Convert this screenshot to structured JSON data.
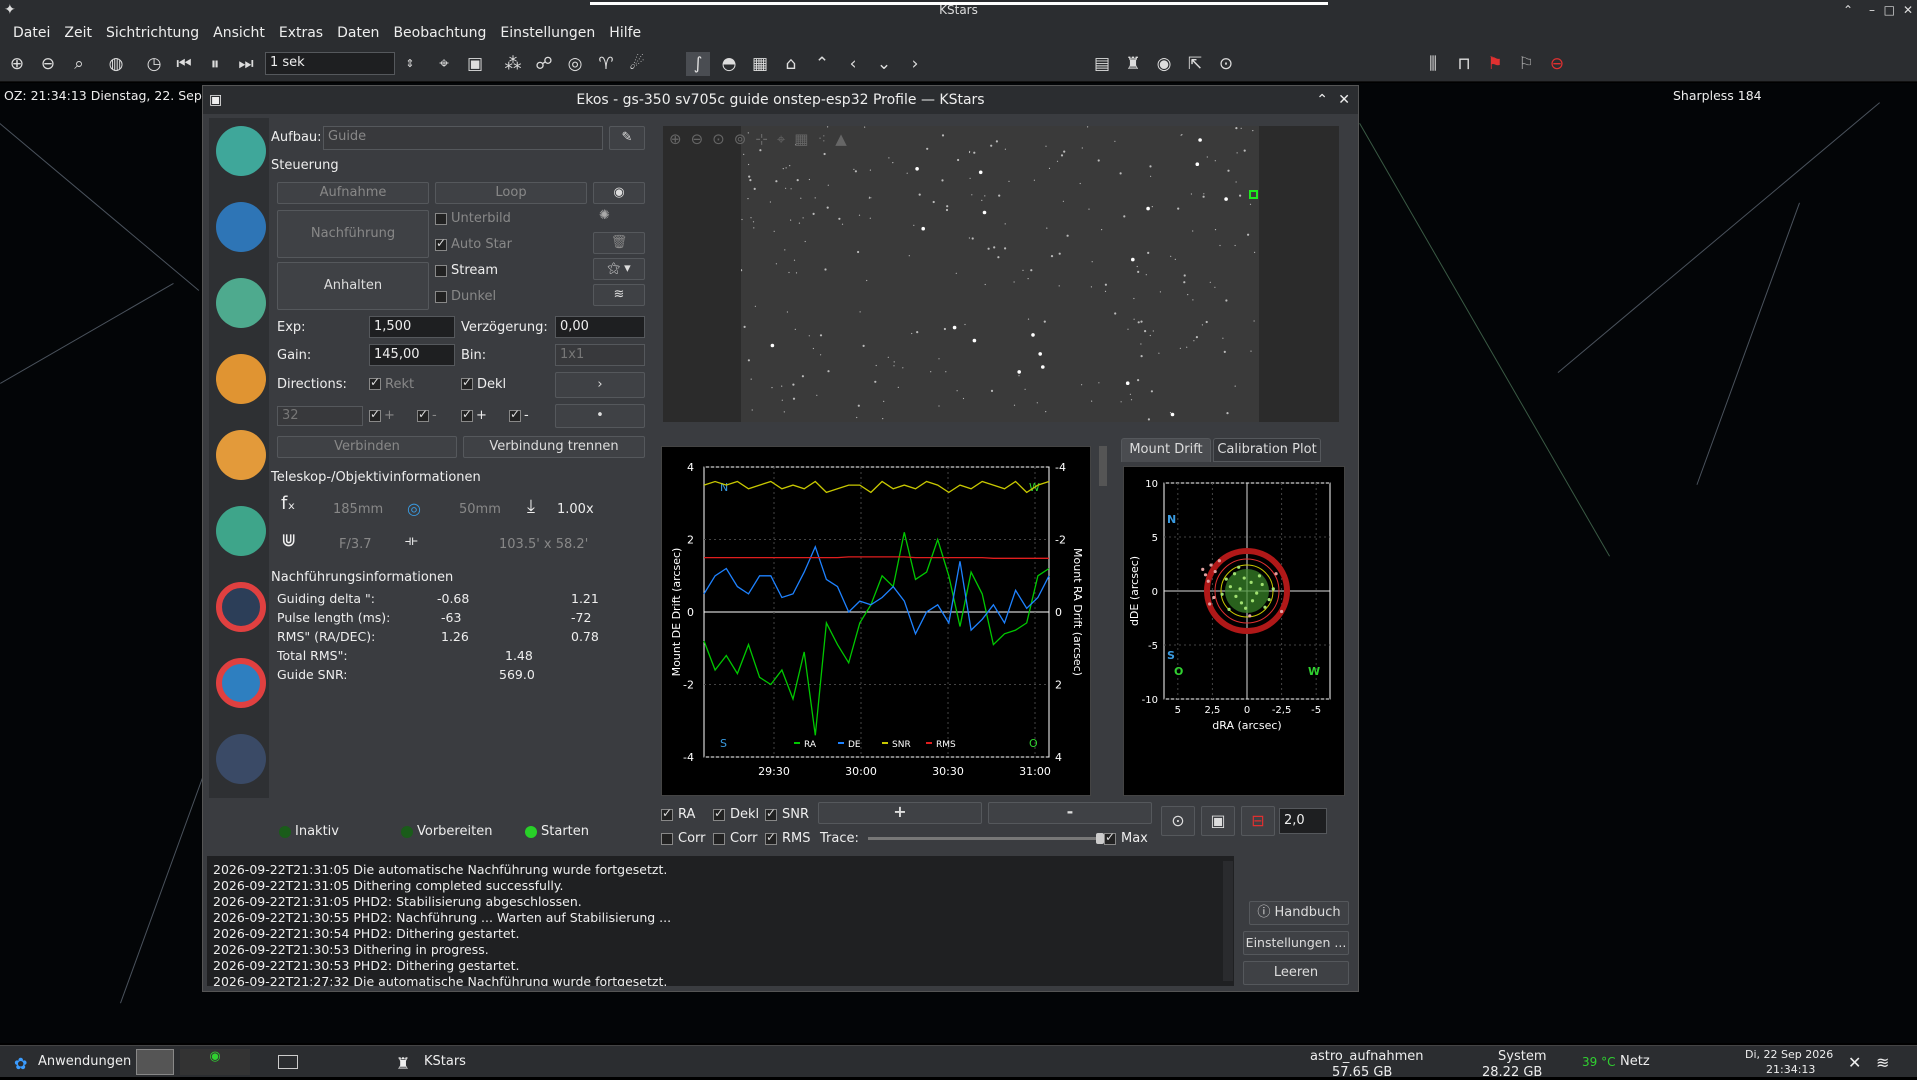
{
  "window_title": "KStars",
  "menu": [
    "Datei",
    "Zeit",
    "Sichtrichtung",
    "Ansicht",
    "Extras",
    "Daten",
    "Beobachtung",
    "Einstellungen",
    "Hilfe"
  ],
  "toolbar": {
    "time_step": "1 sek"
  },
  "sky": {
    "clock": "OZ: 21:34:13  Dienstag, 22. Sep",
    "object": "Sharpless 184"
  },
  "ekos": {
    "title": "Ekos - gs-350 sv705c guide onstep-esp32 Profile — KStars",
    "setup_label": "Aufbau:",
    "setup_value": "Guide",
    "control_title": "Steuerung",
    "capture_btn": "Aufnahme",
    "loop_btn": "Loop",
    "guide_btn": "Nachführung",
    "stop_btn": "Anhalten",
    "subframe": "Unterbild",
    "autostar": "Auto Star",
    "stream": "Stream",
    "dark": "Dunkel",
    "exp_label": "Exp:",
    "exp_value": "1,500",
    "delay_label": "Verzögerung:",
    "delay_value": "0,00",
    "gain_label": "Gain:",
    "gain_value": "145,00",
    "bin_label": "Bin:",
    "bin_value": "1x1",
    "directions_label": "Directions:",
    "ra_label": "Rekt",
    "de_label": "Dekl",
    "box_value": "32",
    "plus": "+",
    "minus": "-",
    "connect_btn": "Verbinden",
    "disconnect_btn": "Verbindung trennen",
    "scope_title": "Teleskop-/Objektivinformationen",
    "focal": "185mm",
    "aperture": "50mm",
    "reducer": "1.00x",
    "fratio": "F/3.7",
    "fov": "103.5' x 58.2'",
    "guide_info_title": "Nachführungsinformationen",
    "delta_label": "Guiding delta \":",
    "delta_ra": "-0.68",
    "delta_de": "1.21",
    "pulse_label": "Pulse length (ms):",
    "pulse_ra": "-63",
    "pulse_de": "-72",
    "rms_label": "RMS\" (RA/DEC):",
    "rms_ra": "1.26",
    "rms_de": "0.78",
    "total_rms_label": "Total RMS\":",
    "total_rms": "1.48",
    "snr_label": "Guide SNR:",
    "snr": "569.0",
    "status_inactive": "Inaktiv",
    "status_prepare": "Vorbereiten",
    "status_start": "Starten",
    "tab_drift": "Mount Drift",
    "tab_calib": "Calibration Plot",
    "cb_ra": "RA",
    "cb_dekl": "Dekl",
    "cb_snr": "SNR",
    "cb_corr1": "Corr",
    "cb_corr2": "Corr",
    "cb_rms": "RMS",
    "trace_label": "Trace:",
    "max_label": "Max",
    "zoom_value": "2,0",
    "btn_plus": "+",
    "btn_minus": "-",
    "handbook": "Handbuch",
    "settings": "Einstellungen ...",
    "clear": "Leeren"
  },
  "log": [
    "2026-09-22T21:31:05 Die automatische Nachführung wurde fortgesetzt.",
    "2026-09-22T21:31:05 Dithering completed successfully.",
    "2026-09-22T21:31:05 PHD2: Stabilisierung abgeschlossen.",
    "2026-09-22T21:30:55 PHD2: Nachführung ... Warten auf Stabilisierung ...",
    "2026-09-22T21:30:54 PHD2: Dithering gestartet.",
    "2026-09-22T21:30:53 Dithering in progress.",
    "2026-09-22T21:30:53 PHD2: Dithering gestartet.",
    "2026-09-22T21:27:32 Die automatische Nachführung wurde fortgesetzt."
  ],
  "chart_data": [
    {
      "type": "line",
      "title": "",
      "xlabel": "",
      "ylabel": "Mount DE Drift (arcsec)",
      "y2label": "Mount RA Drift (arcsec)",
      "x_ticks": [
        "29:30",
        "30:00",
        "30:30",
        "31:00"
      ],
      "ylim": [
        -4,
        4
      ],
      "y2lim": [
        4,
        -4
      ],
      "corner_labels": {
        "top_left": "N",
        "top_right": "W",
        "bottom_left": "S",
        "bottom_right": "O"
      },
      "legend": [
        "RA",
        "DE",
        "SNR",
        "RMS"
      ],
      "series": [
        {
          "name": "RA",
          "color": "#00c800",
          "values": [
            -0.8,
            -1.6,
            -1.2,
            -1.7,
            -0.9,
            -1.8,
            -2.0,
            -1.6,
            -2.4,
            -1.1,
            -3.4,
            -0.3,
            -0.9,
            -1.4,
            -0.3,
            0.2,
            1.0,
            0.7,
            2.2,
            0.9,
            1.1,
            2.0,
            1.0,
            -0.4,
            1.1,
            0.5,
            -0.9,
            -0.6,
            -0.5,
            -0.3,
            1.0,
            1.2
          ]
        },
        {
          "name": "DE",
          "color": "#1e82ff",
          "values": [
            0.5,
            1.0,
            1.2,
            0.7,
            0.5,
            1.0,
            1.0,
            0.4,
            0.5,
            1.1,
            1.8,
            0.9,
            0.7,
            0.0,
            0.3,
            0.2,
            0.4,
            0.7,
            0.3,
            -0.6,
            0.0,
            0.2,
            -0.3,
            1.4,
            -0.5,
            -0.2,
            0.2,
            -0.3,
            0.6,
            0.1,
            0.4,
            1.0
          ]
        },
        {
          "name": "RMS",
          "color": "#e01e1e",
          "values": [
            1.5,
            1.5,
            1.5,
            1.5,
            1.5,
            1.5,
            1.5,
            1.5,
            1.5,
            1.5,
            1.5,
            1.5,
            1.5,
            1.52,
            1.52,
            1.52,
            1.52,
            1.52,
            1.52,
            1.5,
            1.5,
            1.5,
            1.5,
            1.5,
            1.5,
            1.5,
            1.48,
            1.48,
            1.48,
            1.48,
            1.48,
            1.48
          ]
        },
        {
          "name": "SNR",
          "color": "#c8c800",
          "values": [
            3.5,
            3.6,
            3.5,
            3.6,
            3.4,
            3.5,
            3.6,
            3.4,
            3.5,
            3.4,
            3.6,
            3.3,
            3.4,
            3.5,
            3.5,
            3.3,
            3.6,
            3.4,
            3.5,
            3.4,
            3.6,
            3.5,
            3.3,
            3.5,
            3.4,
            3.6,
            3.5,
            3.4,
            3.6,
            3.3,
            3.5,
            3.6
          ]
        }
      ]
    },
    {
      "type": "scatter",
      "title": "",
      "xlabel": "dRA (arcsec)",
      "ylabel": "dDE (arcsec)",
      "x_ticks": [
        "5",
        "2,5",
        "0",
        "-2,5",
        "-5"
      ],
      "y_ticks": [
        "10",
        "5",
        "0",
        "-5",
        "-10"
      ],
      "xlim": [
        6,
        -6
      ],
      "ylim": [
        -10,
        10
      ],
      "corner_labels": {
        "top_left": "N",
        "bottom_left": "S",
        "bottom_right": "W",
        "bottom_left2": "O"
      },
      "points": [
        [
          0.5,
          0.2
        ],
        [
          -0.3,
          0.8
        ],
        [
          0.8,
          -0.5
        ],
        [
          -0.7,
          -0.2
        ],
        [
          0.2,
          1.2
        ],
        [
          1.2,
          0.4
        ],
        [
          -1.1,
          0.6
        ],
        [
          0.4,
          -1.1
        ],
        [
          -0.4,
          -0.9
        ],
        [
          1.5,
          1.1
        ],
        [
          -1.6,
          -0.8
        ],
        [
          0.9,
          1.6
        ],
        [
          -0.9,
          1.4
        ],
        [
          1.8,
          -0.3
        ],
        [
          -1.9,
          0.2
        ],
        [
          0.1,
          -1.6
        ],
        [
          2.3,
          1.8
        ],
        [
          2.6,
          2.4
        ],
        [
          2.8,
          0.9
        ],
        [
          3.0,
          1.5
        ],
        [
          2.4,
          -0.6
        ],
        [
          1.3,
          -1.7
        ],
        [
          -1.3,
          -1.5
        ],
        [
          -2.1,
          1.6
        ],
        [
          2.0,
          2.8
        ],
        [
          3.2,
          2.0
        ],
        [
          -2.5,
          -1.9
        ],
        [
          0.6,
          2.2
        ],
        [
          -0.2,
          -2.3
        ],
        [
          2.7,
          -1.2
        ]
      ]
    }
  ]
}
